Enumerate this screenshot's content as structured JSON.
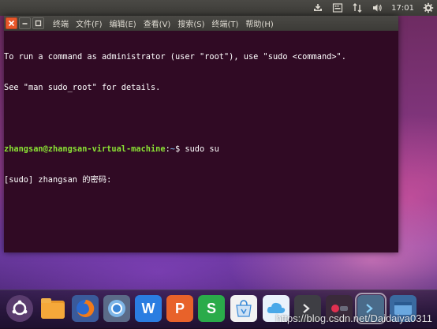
{
  "panel": {
    "clock": "17:01",
    "icons": [
      "software-updater-icon",
      "keyboard-icon",
      "network-icon",
      "volume-icon",
      "settings-gear-icon"
    ]
  },
  "window": {
    "menu": {
      "terminal": "终端",
      "file": "文件(F)",
      "edit": "编辑(E)",
      "view": "查看(V)",
      "search": "搜索(S)",
      "terminal_menu": "终端(T)",
      "help": "帮助(H)"
    }
  },
  "terminal": {
    "line1": "To run a command as administrator (user \"root\"), use \"sudo <command>\".",
    "line2": "See \"man sudo_root\" for details.",
    "prompt_user": "zhangsan@zhangsan-virtual-machine",
    "prompt_sep": ":",
    "prompt_path": "~",
    "prompt_cmd": "$ sudo su",
    "line4": "[sudo] zhangsan 的密码: "
  },
  "dock": {
    "items": [
      "ubuntu-logo-icon",
      "files-icon",
      "firefox-icon",
      "chromium-icon",
      "wps-writer-icon",
      "wps-presentation-icon",
      "wps-spreadsheet-icon",
      "software-store-icon",
      "cloud-app-icon",
      "terminal-icon",
      "screen-recorder-icon",
      "terminal-active-icon",
      "app-icon"
    ],
    "wps_writer_letter": "W",
    "wps_presentation_letter": "P",
    "wps_spreadsheet_letter": "S"
  },
  "watermark": "https://blog.csdn.net/Daidaiya0311",
  "colors": {
    "terminal_bg": "#300a24",
    "prompt_user": "#8ae234",
    "prompt_path": "#729fcf",
    "close_button": "#e8572a"
  }
}
